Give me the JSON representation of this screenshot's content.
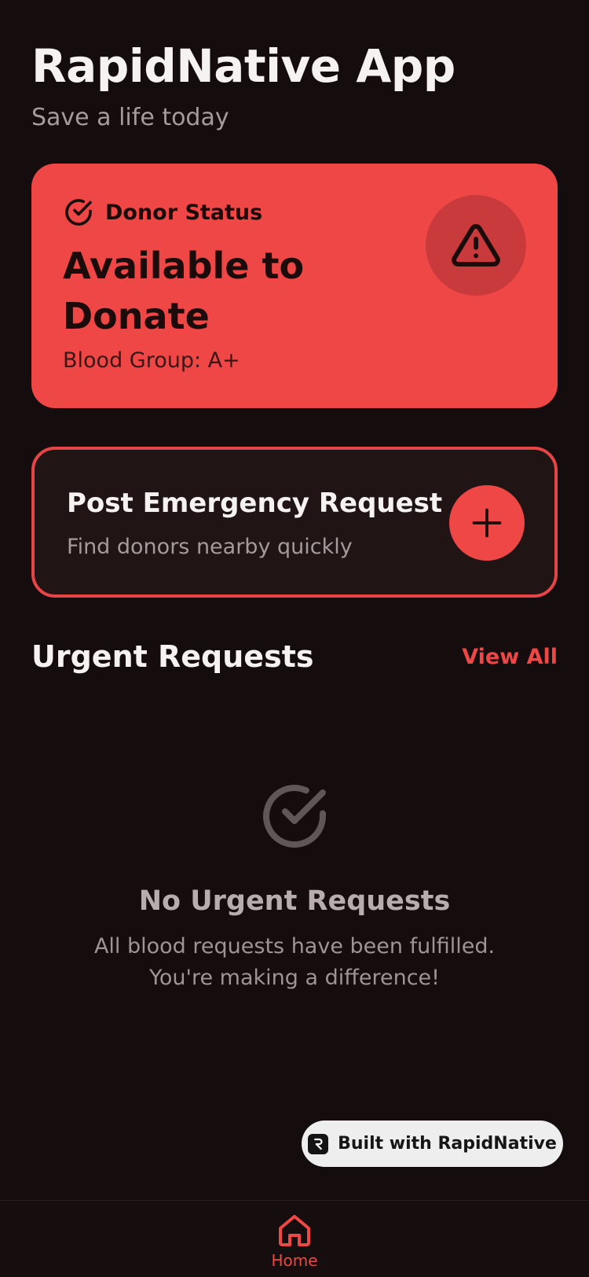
{
  "header": {
    "title": "RapidNative App",
    "subtitle": "Save a life today"
  },
  "donor_card": {
    "label": "Donor Status",
    "status": "Available to Donate",
    "blood_group": "Blood Group: A+",
    "label_icon": "check-circle-icon",
    "alert_icon": "alert-triangle-icon"
  },
  "emergency_card": {
    "title": "Post Emergency Request",
    "subtitle": "Find donors nearby quickly",
    "button_icon": "plus-icon"
  },
  "urgent_section": {
    "title": "Urgent Requests",
    "view_all": "View All"
  },
  "empty_state": {
    "icon": "check-circle-icon",
    "title": "No Urgent Requests",
    "line1": "All blood requests have been fulfilled.",
    "line2": "You're making a difference!"
  },
  "badge": {
    "text": "Built with RapidNative",
    "icon": "rapidnative-logo-icon"
  },
  "bottom_nav": {
    "items": [
      {
        "label": "Home",
        "icon": "home-icon",
        "active": true
      }
    ]
  },
  "colors": {
    "background": "#140c0d",
    "accent": "#ef4646",
    "card_dark": "#201415"
  }
}
